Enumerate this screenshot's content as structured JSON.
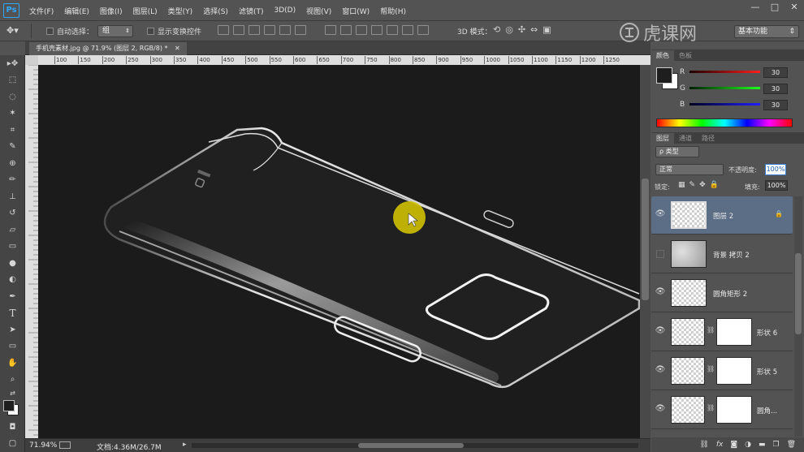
{
  "app": {
    "logo": "Ps"
  },
  "menu": [
    "文件(F)",
    "编辑(E)",
    "图像(I)",
    "图层(L)",
    "类型(Y)",
    "选择(S)",
    "滤镜(T)",
    "3D(D)",
    "视图(V)",
    "窗口(W)",
    "帮助(H)"
  ],
  "window_buttons": [
    "—",
    "□",
    "✕"
  ],
  "options": {
    "auto_select_label": "自动选择：",
    "auto_select_value": "组",
    "show_transform": "显示变换控件",
    "mode3d": "3D 模式：",
    "workspace": "基本功能"
  },
  "document": {
    "tab_title": "手机壳素材.jpg @ 71.9% (图层 2, RGB/8) *",
    "zoom": "71.94%",
    "doc_size": "文档:4.36M/26.7M"
  },
  "ruler_ticks": [
    "100",
    "150",
    "200",
    "250",
    "300",
    "350",
    "400",
    "450",
    "500",
    "550",
    "600",
    "650",
    "700",
    "750",
    "800",
    "850",
    "900",
    "950",
    "1000",
    "1050",
    "1100",
    "1150",
    "1200",
    "1250"
  ],
  "watermark": {
    "text": "虎课网"
  },
  "color_panel": {
    "tabs": [
      "颜色",
      "色板"
    ],
    "r_label": "R",
    "g_label": "G",
    "b_label": "B",
    "r": "30",
    "g": "30",
    "b": "30",
    "fg_color": "#1e1e1e"
  },
  "layers_panel": {
    "tabs": [
      "图层",
      "通道",
      "路径"
    ],
    "filter": "ρ 类型",
    "blend_mode": "正常",
    "opacity_label": "不透明度:",
    "opacity": "100%",
    "lock_label": "锁定:",
    "fill_label": "填充:",
    "fill": "100%",
    "layers": [
      {
        "name": "图层 2",
        "selected": true,
        "visible": true
      },
      {
        "name": "背景 拷贝 2",
        "selected": false,
        "visible": false
      },
      {
        "name": "圆角矩形 2",
        "selected": false,
        "visible": true
      },
      {
        "name": "形状 6",
        "selected": false,
        "visible": true
      },
      {
        "name": "形状 5",
        "selected": false,
        "visible": true
      },
      {
        "name": "圆角...",
        "selected": false,
        "visible": true
      }
    ],
    "footer_icons": [
      "link-icon",
      "fx-icon",
      "mask-icon",
      "adjustment-icon",
      "group-icon",
      "new-layer-icon",
      "trash-icon"
    ]
  },
  "colors": {
    "accent": "#31a8ff",
    "selected_layer": "#5b6e86",
    "canvas_bg": "#1b1b1b",
    "cursor_highlight": "#d4c400"
  }
}
